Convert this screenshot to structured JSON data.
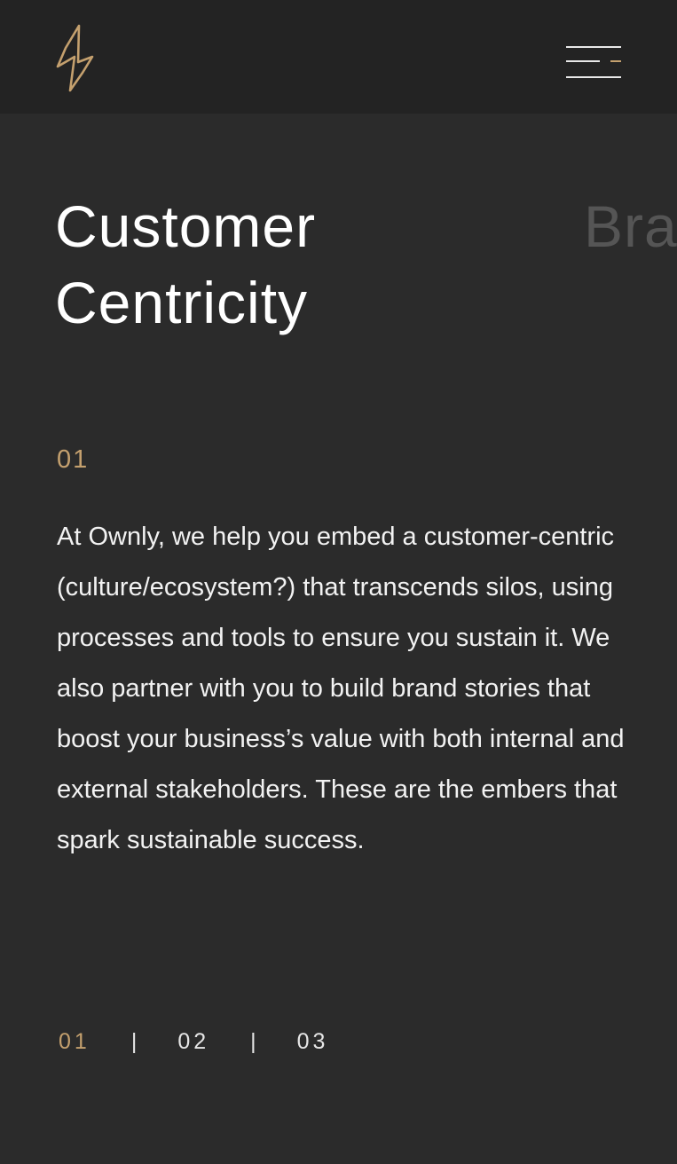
{
  "header": {
    "logo_icon": "lightning-bolt-logo",
    "menu_icon": "hamburger-menu-icon",
    "accent_color": "#c4a06e"
  },
  "slides": {
    "current": {
      "title_line1": "Customer",
      "title_line2": "Centricity",
      "number": "01",
      "body": "At Ownly, we help you embed a customer-centric (culture/ecosystem?) that transcends silos, using processes and tools to ensure you sustain it. We also partner with you to build brand stories that boost your business’s value with both internal and external stakeholders.  These are the embers that spark sustainable success."
    },
    "next_peek": "Bra"
  },
  "pager": {
    "items": [
      "01",
      "02",
      "03"
    ],
    "separator": "|",
    "active": "01"
  }
}
